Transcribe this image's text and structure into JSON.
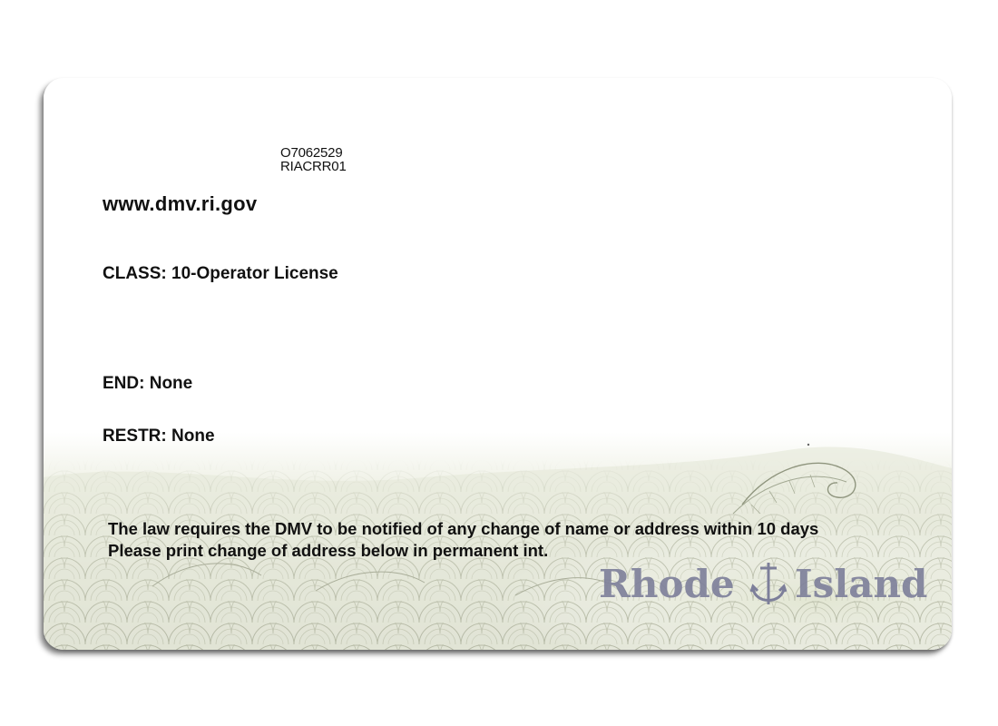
{
  "card": {
    "document_number": "O7062529",
    "audit_code": "RIACRR01",
    "website": "www.dmv.ri.gov",
    "class_label": "CLASS:",
    "class_value": "10-Operator License",
    "endorsements_label": "END:",
    "endorsements_value": "None",
    "restrictions_label": "RESTR:",
    "restrictions_value": "None",
    "notice_line_1": "The law requires the DMV to be notified of any change of name or address within 10 days",
    "notice_line_2": "Please print change of address below in permanent int.",
    "brand_word_1": "Rhode",
    "brand_word_2": "Island",
    "brand_emblem_icon": "anchor-icon"
  },
  "colors": {
    "text": "#111111",
    "brand": "#7d7f9a",
    "wave_pattern": "#c8ccba"
  }
}
